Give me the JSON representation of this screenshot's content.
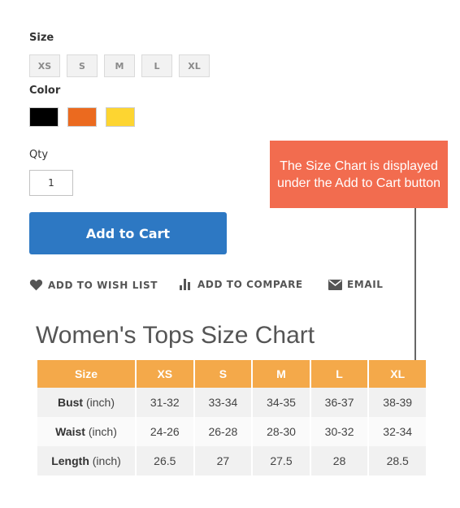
{
  "options": {
    "size_label": "Size",
    "sizes": [
      "XS",
      "S",
      "M",
      "L",
      "XL"
    ],
    "color_label": "Color",
    "colors": [
      "#000000",
      "#eb6a1f",
      "#fdd531"
    ],
    "qty_label": "Qty",
    "qty_value": "1"
  },
  "cart": {
    "add_label": "Add to Cart"
  },
  "actions": {
    "wishlist": "ADD TO WISH LIST",
    "compare": "ADD TO COMPARE",
    "email": "EMAIL"
  },
  "callout": {
    "text": "The Size Chart is displayed under the Add to Cart button"
  },
  "size_chart": {
    "title": "Women's Tops Size Chart",
    "header": [
      "Size",
      "XS",
      "S",
      "M",
      "L",
      "XL"
    ],
    "header_color": "#f4a94a",
    "rows": [
      {
        "label": "Bust",
        "unit": "(inch)",
        "values": [
          "31-32",
          "33-34",
          "34-35",
          "36-37",
          "38-39"
        ]
      },
      {
        "label": "Waist",
        "unit": "(inch)",
        "values": [
          "24-26",
          "26-28",
          "28-30",
          "30-32",
          "32-34"
        ]
      },
      {
        "label": "Length",
        "unit": "(inch)",
        "values": [
          "26.5",
          "27",
          "27.5",
          "28",
          "28.5"
        ]
      }
    ]
  }
}
